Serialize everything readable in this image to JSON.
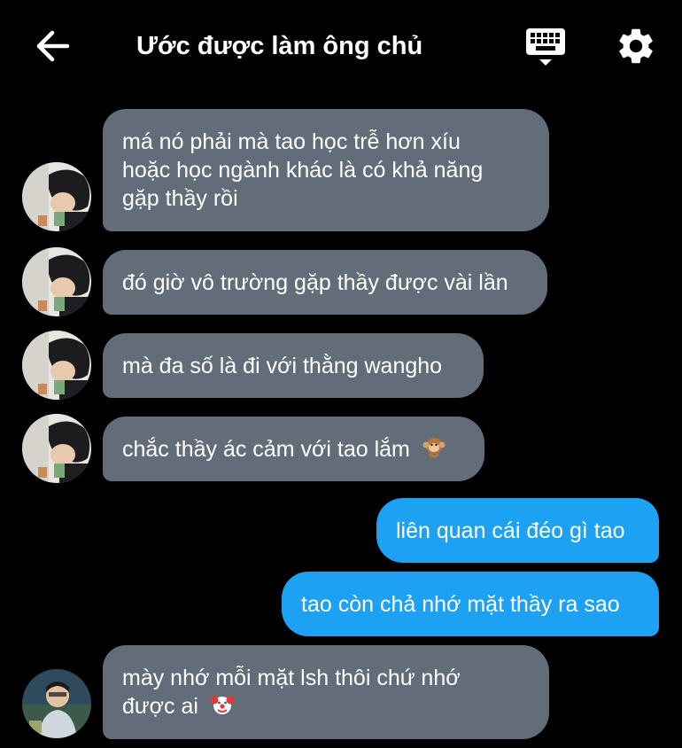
{
  "header": {
    "title": "Ước được làm ông chủ",
    "back_icon": "arrow-left-icon",
    "keyboard_icon": "keyboard-icon",
    "settings_icon": "gear-icon"
  },
  "colors": {
    "background": "#000000",
    "incoming_bubble": "#626d79",
    "outgoing_bubble": "#1da1f2",
    "text": "#ffffff"
  },
  "messages": [
    {
      "direction": "incoming",
      "lines": [
        "má nó phải mà tao học trễ hơn xíu",
        "hoặc học ngành khác là có khả năng",
        "gặp thầy rồi"
      ]
    },
    {
      "direction": "incoming",
      "lines": [
        "đó giờ vô trường gặp thầy được vài lần"
      ]
    },
    {
      "direction": "incoming",
      "lines": [
        "mà đa số là đi với thằng wangho"
      ]
    },
    {
      "direction": "incoming",
      "lines": [
        "chắc thầy ác cảm với tao lắm"
      ],
      "emoji": "monkey-emoji"
    },
    {
      "direction": "outgoing",
      "lines": [
        "liên quan cái đéo gì tao"
      ]
    },
    {
      "direction": "outgoing",
      "lines": [
        "tao còn chả nhớ mặt thầy ra sao"
      ]
    },
    {
      "direction": "incoming",
      "lines": [
        "mày nhớ mỗi mặt lsh thôi chứ nhớ",
        "được ai"
      ],
      "emoji": "clown-emoji"
    }
  ]
}
